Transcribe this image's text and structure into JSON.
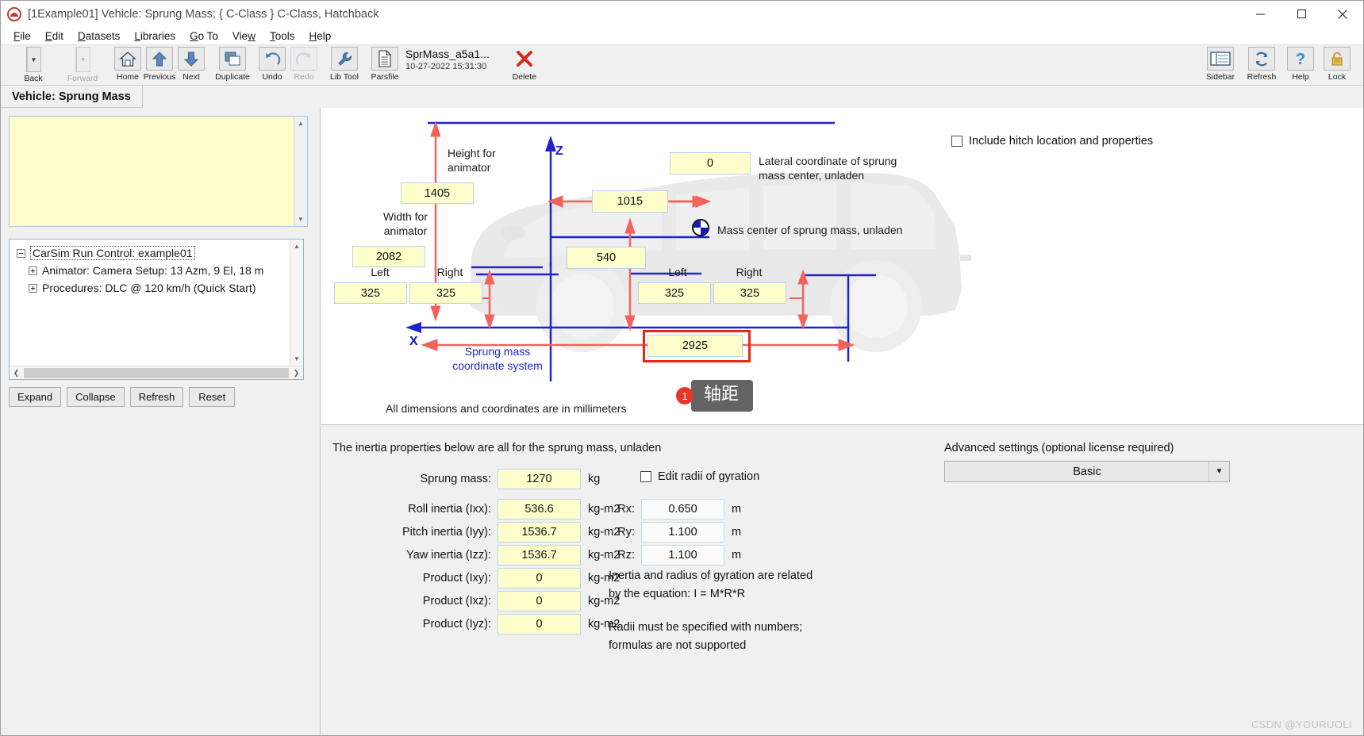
{
  "window": {
    "title": "[1Example01] Vehicle: Sprung Mass; { C-Class } C-Class, Hatchback",
    "minimize_label": "Minimize",
    "maximize_label": "Maximize",
    "close_label": "Close"
  },
  "menubar": {
    "items": [
      {
        "label": "File",
        "accel": "F"
      },
      {
        "label": "Edit",
        "accel": "E"
      },
      {
        "label": "Datasets",
        "accel": "D"
      },
      {
        "label": "Libraries",
        "accel": "L"
      },
      {
        "label": "Go To",
        "accel": "G"
      },
      {
        "label": "View",
        "accel": "w"
      },
      {
        "label": "Tools",
        "accel": "T"
      },
      {
        "label": "Help",
        "accel": "H"
      }
    ]
  },
  "toolbar": {
    "left": [
      {
        "name": "back",
        "label": "Back",
        "icon": "left-arrow-icon",
        "enabled": true,
        "split": true
      },
      {
        "name": "forward",
        "label": "Forward",
        "icon": "right-arrow-icon",
        "enabled": false,
        "split": true
      },
      {
        "name": "home",
        "label": "Home",
        "icon": "home-icon",
        "enabled": true
      },
      {
        "name": "previous",
        "label": "Previous",
        "icon": "up-arrow-icon",
        "enabled": true
      },
      {
        "name": "next",
        "label": "Next",
        "icon": "down-arrow-icon",
        "enabled": true
      },
      {
        "name": "duplicate",
        "label": "Duplicate",
        "icon": "copy-icon",
        "enabled": true
      },
      {
        "name": "undo",
        "label": "Undo",
        "icon": "undo-icon",
        "enabled": true
      },
      {
        "name": "redo",
        "label": "Redo",
        "icon": "redo-icon",
        "enabled": false
      },
      {
        "name": "libtool",
        "label": "Lib Tool",
        "icon": "wrench-icon",
        "enabled": true
      },
      {
        "name": "parsfile",
        "label": "Parsfile",
        "icon": "document-icon",
        "enabled": true
      },
      {
        "name": "delete",
        "label": "Delete",
        "icon": "x-icon",
        "enabled": true
      }
    ],
    "parsfile": {
      "name": "SprMass_a5a1...",
      "timestamp": "10-27-2022 15:31:30"
    },
    "right": [
      {
        "name": "sidebar",
        "label": "Sidebar",
        "icon": "sidebar-icon"
      },
      {
        "name": "refresh",
        "label": "Refresh",
        "icon": "refresh-icon"
      },
      {
        "name": "help",
        "label": "Help",
        "icon": "question-mark-icon"
      },
      {
        "name": "lock",
        "label": "Lock",
        "icon": "padlock-icon"
      }
    ]
  },
  "page": {
    "tab_title": "Vehicle: Sprung Mass"
  },
  "sidebar": {
    "notes_value": "",
    "tree": [
      {
        "label": "CarSim Run Control: example01",
        "level": 0,
        "expanded": true,
        "selected": true
      },
      {
        "label": "Animator: Camera Setup: 13 Azm, 9 El, 18 m",
        "level": 1,
        "expanded": false,
        "selected": false
      },
      {
        "label": "Procedures: DLC @ 120 km/h (Quick Start)",
        "level": 1,
        "expanded": false,
        "selected": false
      }
    ],
    "buttons": [
      "Expand",
      "Collapse",
      "Refresh",
      "Reset"
    ]
  },
  "diagram": {
    "hitch_checkbox_label": "Include hitch location and properties",
    "hitch_checked": false,
    "height_for_animator_label": "Height for\nanimator",
    "height_for_animator_value": "1405",
    "width_for_animator_label": "Width for\nanimator",
    "width_for_animator_value": "2082",
    "z_axis_label": "Z",
    "x_axis_label": "X",
    "cg_x_value": "1015",
    "cg_z_value": "540",
    "lateral_value": "0",
    "lateral_label": "Lateral coordinate of sprung\nmass center, unladen",
    "mass_center_label": "Mass center of sprung mass, unladen",
    "coord_system_label": "Sprung mass\ncoordinate system",
    "front_left_label": "Left",
    "front_right_label": "Right",
    "front_left_value": "325",
    "front_right_value": "325",
    "rear_left_label": "Left",
    "rear_right_label": "Right",
    "rear_left_value": "325",
    "rear_right_value": "325",
    "wheelbase_value": "2925",
    "units_note": "All dimensions and coordinates are in millimeters",
    "annotation": {
      "number": "1",
      "text": "轴距"
    }
  },
  "inertia": {
    "heading": "The inertia properties below are all for the sprung mass, unladen",
    "rows": [
      {
        "label": "Sprung mass:",
        "value": "1270",
        "unit": "kg"
      },
      {
        "label": "Roll inertia (Ixx):",
        "value": "536.6",
        "unit": "kg-m2"
      },
      {
        "label": "Pitch inertia (Iyy):",
        "value": "1536.7",
        "unit": "kg-m2"
      },
      {
        "label": "Yaw inertia (Izz):",
        "value": "1536.7",
        "unit": "kg-m2"
      },
      {
        "label": "Product (Ixy):",
        "value": "0",
        "unit": "kg-m2"
      },
      {
        "label": "Product (Ixz):",
        "value": "0",
        "unit": "kg-m2"
      },
      {
        "label": "Product (Iyz):",
        "value": "0",
        "unit": "kg-m2"
      }
    ]
  },
  "gyration": {
    "checkbox_label": "Edit radii of gyration",
    "checked": false,
    "rows": [
      {
        "label": "Rx:",
        "value": "0.650",
        "unit": "m"
      },
      {
        "label": "Ry:",
        "value": "1.100",
        "unit": "m"
      },
      {
        "label": "Rz:",
        "value": "1.100",
        "unit": "m"
      }
    ],
    "note1": "Inertia and radius of gyration are related",
    "note2": "by the equation: I = M*R*R",
    "note3": "Radii must be specified with numbers;",
    "note4": "formulas are not supported"
  },
  "advanced": {
    "label": "Advanced settings (optional license required)",
    "selected": "Basic"
  },
  "watermark": "CSDN @YOURUOLI",
  "colors": {
    "dimension_red": "#f2635c",
    "axis_blue": "#2222cc",
    "field_yellow": "#ffffcc",
    "highlight_red": "#e8271a",
    "annotation_gray": "#636363"
  }
}
